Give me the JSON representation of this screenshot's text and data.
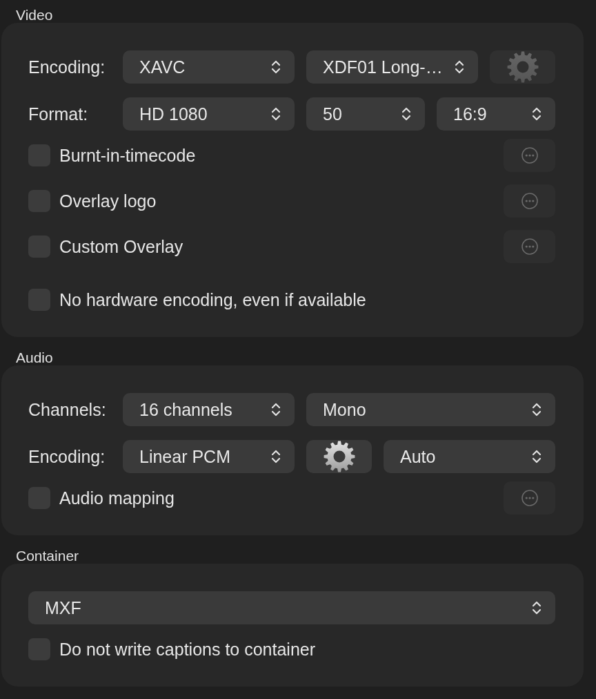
{
  "sections": [
    {
      "title": "Video",
      "rows": [
        {
          "kind": "controls",
          "label": "Encoding:",
          "controls": [
            {
              "kind": "popup",
              "value": "XAVC"
            },
            {
              "kind": "popup",
              "value": "XDF01 Long-…"
            },
            {
              "kind": "gear_button",
              "disabled": true
            }
          ]
        },
        {
          "kind": "controls",
          "label": "Format:",
          "controls": [
            {
              "kind": "popup",
              "value": "HD 1080"
            },
            {
              "kind": "popup",
              "value": "50"
            },
            {
              "kind": "popup",
              "value": "16:9"
            }
          ]
        },
        {
          "kind": "checkbox",
          "label": "Burnt-in-timecode",
          "checked": false,
          "options_button": {
            "disabled": true
          }
        },
        {
          "kind": "checkbox",
          "label": "Overlay logo",
          "checked": false,
          "options_button": {
            "disabled": true
          }
        },
        {
          "kind": "checkbox",
          "label": "Custom Overlay",
          "checked": false,
          "options_button": {
            "disabled": true
          }
        },
        {
          "kind": "checkbox",
          "label": "No hardware encoding, even if available",
          "checked": false
        }
      ]
    },
    {
      "title": "Audio",
      "rows": [
        {
          "kind": "controls",
          "label": "Channels:",
          "controls": [
            {
              "kind": "popup",
              "value": "16 channels"
            },
            {
              "kind": "popup",
              "value": "Mono"
            }
          ]
        },
        {
          "kind": "controls",
          "label": "Encoding:",
          "controls": [
            {
              "kind": "popup",
              "value": "Linear PCM"
            },
            {
              "kind": "gear_button",
              "disabled": false
            },
            {
              "kind": "popup",
              "value": "Auto"
            }
          ]
        },
        {
          "kind": "checkbox",
          "label": "Audio mapping",
          "checked": false,
          "options_button": {
            "disabled": true
          }
        }
      ]
    },
    {
      "title": "Container",
      "rows": [
        {
          "kind": "controls",
          "controls": [
            {
              "kind": "popup",
              "value": "MXF"
            }
          ]
        },
        {
          "kind": "checkbox",
          "label": "Do not write captions to container",
          "checked": false
        }
      ]
    }
  ]
}
